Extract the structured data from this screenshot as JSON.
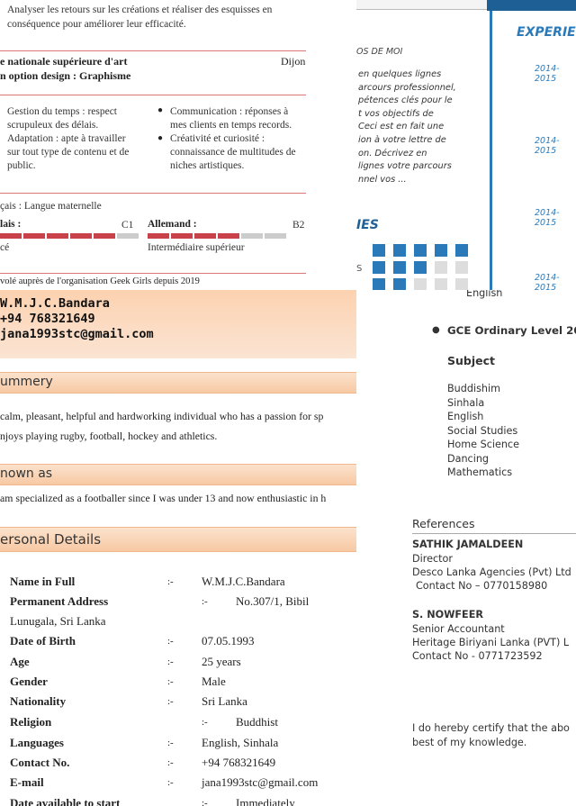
{
  "french_cv": {
    "intro_line1": "Analyser les retours sur les créations et réaliser des esquisses en",
    "intro_line2": "conséquence pour améliorer leur efficacité.",
    "school": "e nationale supérieure d'art",
    "school_city": "Dijon",
    "school_option": "n option design : Graphisme",
    "skills_left": [
      "Gestion du temps : respect",
      "scrupuleux des délais.",
      "Adaptation : apte à travailler",
      "sur tout type de contenu et de",
      "public."
    ],
    "skills_right": [
      "Communication : réponses à",
      "mes clients en temps records.",
      "Créativité et curiosité :",
      "connaissance de multitudes de",
      "niches artistiques."
    ],
    "lang_native": "çais : Langue maternelle",
    "lang1_name": "lais :",
    "lang1_level": "C1",
    "lang1_desc": "cé",
    "lang1_fill": 0.8,
    "lang2_name": "Allemand :",
    "lang2_level": "B2",
    "lang2_desc": "Intermédiaire supérieur",
    "lang2_fill": 0.6,
    "volunteer": "volé auprès de l'organisation Geek Girls depuis 2019"
  },
  "graphic_cv": {
    "section_label": "OS DE MOI",
    "about_lines": [
      "en quelques lignes",
      "arcours professionnel,",
      "pétences clés pour le",
      "t vos objectifs de",
      "Ceci est en fait une",
      "ion à votre lettre de",
      "on. Décrivez en",
      "lignes votre parcours",
      "nnel vos ..."
    ],
    "experience_title": "EXPERIE",
    "years": [
      "2014-2015",
      "2014-2015",
      "2014-2015",
      "2014-2015"
    ],
    "skills_label": "IES",
    "skill_row_prefix": "S",
    "accent_color": "#2a7ab9"
  },
  "main_cv": {
    "header_name": "W.M.J.C.Bandara",
    "header_phone": "+94 768321649",
    "header_email": "jana1993stc@gmail.com",
    "summary_title": "ummery",
    "summary_line1": "calm, pleasant, helpful and hardworking individual who has a passion for sp",
    "summary_line2": "njoys playing rugby, football, hockey and athletics.",
    "known_title": "nown as",
    "known_line": "am specialized as a footballer since I was under 13 and now enthusiastic in h",
    "personal_title": "ersonal Details",
    "separator": ":-",
    "details": [
      {
        "label": "Name in Full",
        "value": "W.M.J.C.Bandara"
      },
      {
        "label": "Permanent Address",
        "value": "No.307/1,      Bibil"
      },
      {
        "label": "Date of Birth",
        "value": "07.05.1993"
      },
      {
        "label": "Age",
        "value": "25 years"
      },
      {
        "label": "Gender",
        "value": "Male"
      },
      {
        "label": "Nationality",
        "value": "Sri Lanka"
      },
      {
        "label": "Religion",
        "value": "Buddhist"
      },
      {
        "label": "Languages",
        "value": "English, Sinhala"
      },
      {
        "label": "Contact No.",
        "value": "+94 768321649"
      },
      {
        "label": "E-mail",
        "value": "jana1993stc@gmail.com"
      },
      {
        "label": "Date available to start",
        "value": "Immediately"
      }
    ],
    "address_line2": "Lunugala, Sri    Lanka",
    "accent_color": "#f7c9a3"
  },
  "right_cv": {
    "english_top": "English",
    "gce_title": "GCE Ordinary Level 20",
    "subject_title": "Subject",
    "subjects": [
      "Buddishim",
      "Sinhala",
      "English",
      "Social Studies",
      "Home Science",
      "Dancing",
      "Mathematics"
    ],
    "references_title": "References",
    "ref1_name": "SATHIK JAMALDEEN",
    "ref1_role": "Director",
    "ref1_company": "Desco Lanka Agencies (Pvt) Ltd",
    "ref1_contact": "Contact No – 0770158980",
    "ref2_name": "S. NOWFEER",
    "ref2_role": "Senior Accountant",
    "ref2_company": "Heritage Biriyani Lanka (PVT) L",
    "ref2_contact": "Contact No - 0771723592",
    "certify_line1": "I do hereby certify that the abo",
    "certify_line2": "best of my knowledge."
  }
}
